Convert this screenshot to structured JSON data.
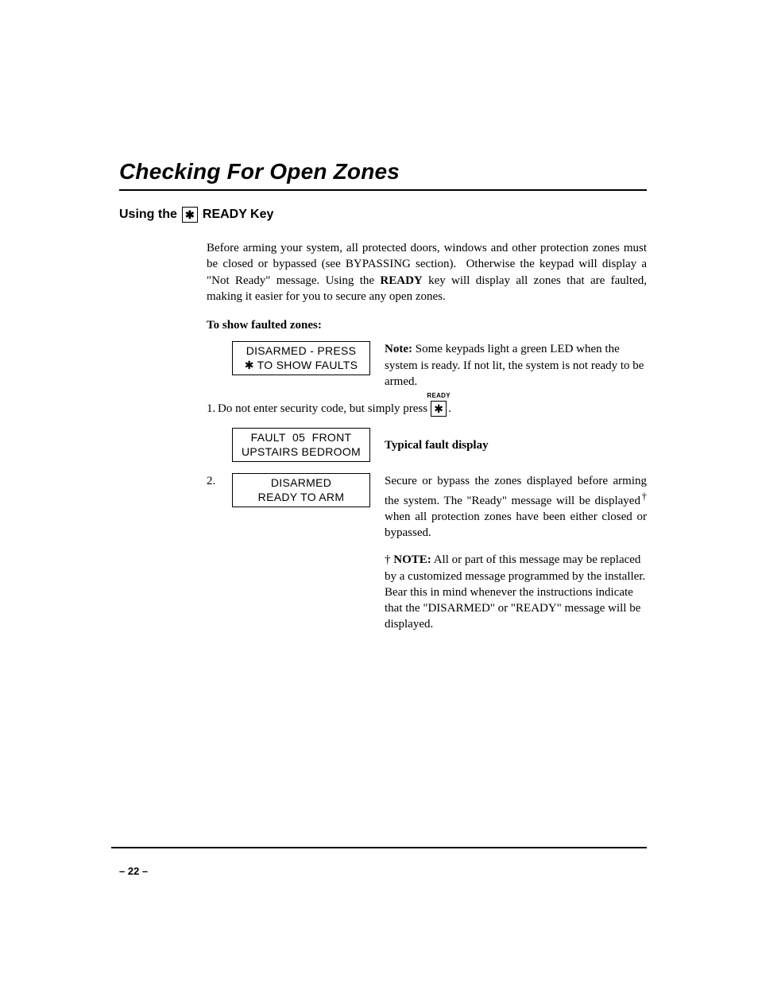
{
  "title": "Checking For Open Zones",
  "subhead": {
    "before": "Using the",
    "key_glyph": "✱",
    "after": " READY Key"
  },
  "intro": "Before arming your system, all protected doors, windows and other protection zones must be closed or bypassed (see BYPASSING section).  Otherwise the keypad will display a \"Not Ready\" message. Using the READY key will display all zones that are faulted, making it easier for you to secure any open zones.",
  "intro_bold_word": "READY",
  "procedure_head": "To show faulted zones:",
  "lcd1": {
    "line1": "DISARMED - PRESS",
    "line2": "✱ TO SHOW FAULTS"
  },
  "note1": {
    "lead": "Note:",
    "text": " Some keypads light a green LED when the system is ready. If not lit, the system is not ready to be armed."
  },
  "step1": {
    "num": "1.",
    "text_before": "  Do not enter security code, but simply press  ",
    "key_label": "READY",
    "key_glyph": "✱",
    "text_after": " ."
  },
  "lcd2": {
    "line1": "FAULT  05  FRONT",
    "line2": "UPSTAIRS BEDROOM"
  },
  "typical_label": "Typical fault display",
  "step2": {
    "num": "2.",
    "lcd": {
      "line1": "DISARMED",
      "line2": "READY TO ARM"
    },
    "text": "Secure or bypass the zones displayed before arming the system. The \"Ready\" message will be displayed† when all protection zones have been either closed or bypassed."
  },
  "note2": {
    "dagger": "†",
    "lead": " NOTE:",
    "text": " All or part of this message may be replaced by a customized message programmed by the installer.  Bear this in mind whenever the instructions indicate that the \"DISARMED\" or \"READY\" message will be displayed."
  },
  "page_number": "– 22 –"
}
